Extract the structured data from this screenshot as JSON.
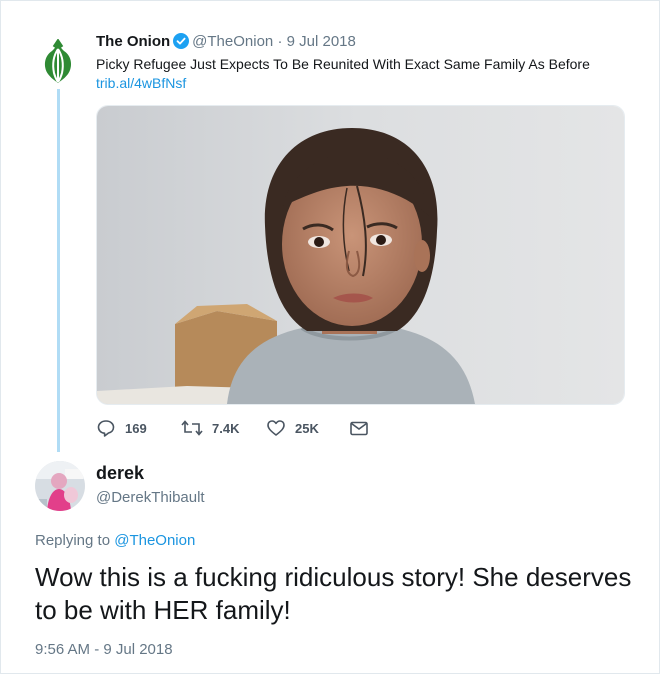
{
  "original_tweet": {
    "display_name": "The Onion",
    "handle": "@TheOnion",
    "separator": "·",
    "date": "9 Jul 2018",
    "text": "Picky Refugee Just Expects To Be Reunited With Exact Same Family As Before",
    "link": "trib.al/4wBfNsf",
    "avatar_icon": "onion-logo-icon",
    "verified_icon": "verified-badge-icon",
    "actions": {
      "reply_count": "169",
      "retweet_count": "7.4K",
      "like_count": "25K"
    }
  },
  "reply_tweet": {
    "display_name": "derek",
    "handle": "@DerekThibault",
    "replying_prefix": "Replying to",
    "replying_handle": "@TheOnion",
    "text": "Wow this is a fucking ridiculous story! She deserves to be with HER family!",
    "timestamp": "9:56 AM - 9 Jul 2018"
  },
  "colors": {
    "link": "#1b95e0",
    "thread_line": "#b0dcf5",
    "onion_green": "#2f8a34",
    "muted_text": "#657786"
  }
}
